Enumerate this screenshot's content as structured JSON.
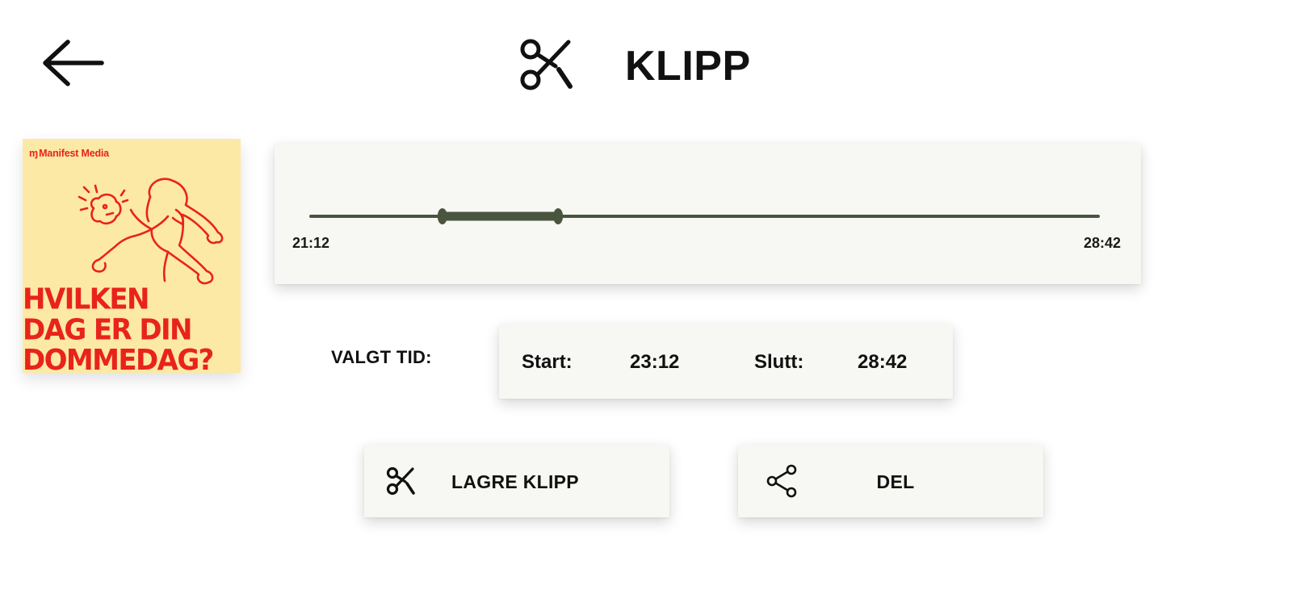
{
  "header": {
    "back_icon": "arrow-left-icon",
    "title_icon": "scissors-icon",
    "title": "KLIPP"
  },
  "cover": {
    "publisher": "Manifest Media",
    "title_lines": [
      "HVILKEN",
      "DAG ER DIN",
      "DOMMEDAG?"
    ],
    "colors": {
      "background": "#fde9a6",
      "ink": "#e8231d"
    }
  },
  "timeline": {
    "start_time": "21:12",
    "end_time": "28:42",
    "selection_start_fraction": 0.167,
    "selection_end_fraction": 0.314,
    "track_color": "#4a5540"
  },
  "selection": {
    "label": "VALGT TID:",
    "start_label": "Start:",
    "start_value": "23:12",
    "end_label": "Slutt:",
    "end_value": "28:42"
  },
  "actions": {
    "save_icon": "scissors-icon",
    "save_label": "LAGRE KLIPP",
    "share_icon": "share-icon",
    "share_label": "DEL"
  },
  "colors": {
    "card_background": "#f7f7f3",
    "text": "#111111",
    "accent": "#4a5540"
  }
}
